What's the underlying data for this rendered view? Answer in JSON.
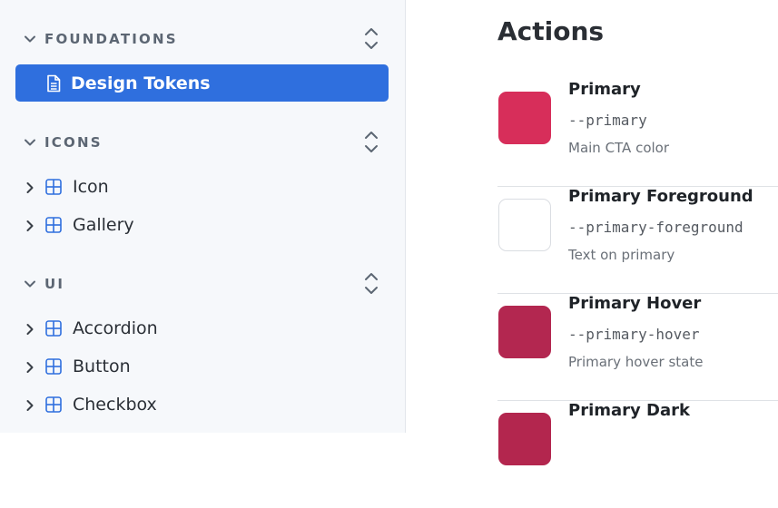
{
  "sidebar": {
    "sections": [
      {
        "title": "FOUNDATIONS"
      },
      {
        "title": "ICONS"
      },
      {
        "title": "UI"
      }
    ],
    "selected_item": {
      "label": "Design Tokens",
      "icon": "document-icon"
    },
    "icons_items": [
      {
        "label": "Icon",
        "icon": "component-grid-icon"
      },
      {
        "label": "Gallery",
        "icon": "component-grid-icon"
      }
    ],
    "ui_items": [
      {
        "label": "Accordion",
        "icon": "component-grid-icon"
      },
      {
        "label": "Button",
        "icon": "component-grid-icon"
      },
      {
        "label": "Checkbox",
        "icon": "component-grid-icon"
      }
    ]
  },
  "main": {
    "title": "Actions",
    "tokens": [
      {
        "name": "Primary",
        "variable": "--primary",
        "description": "Main CTA color",
        "color": "#d72e5a"
      },
      {
        "name": "Primary Foreground",
        "variable": "--primary-foreground",
        "description": "Text on primary",
        "color": "#ffffff"
      },
      {
        "name": "Primary Hover",
        "variable": "--primary-hover",
        "description": "Primary hover state",
        "color": "#b32750"
      },
      {
        "name": "Primary Dark",
        "variable": "",
        "description": "",
        "color": "#b3264e"
      }
    ]
  },
  "colors": {
    "accent": "#2f6fde",
    "sidebar_bg": "#f6f8fb"
  }
}
